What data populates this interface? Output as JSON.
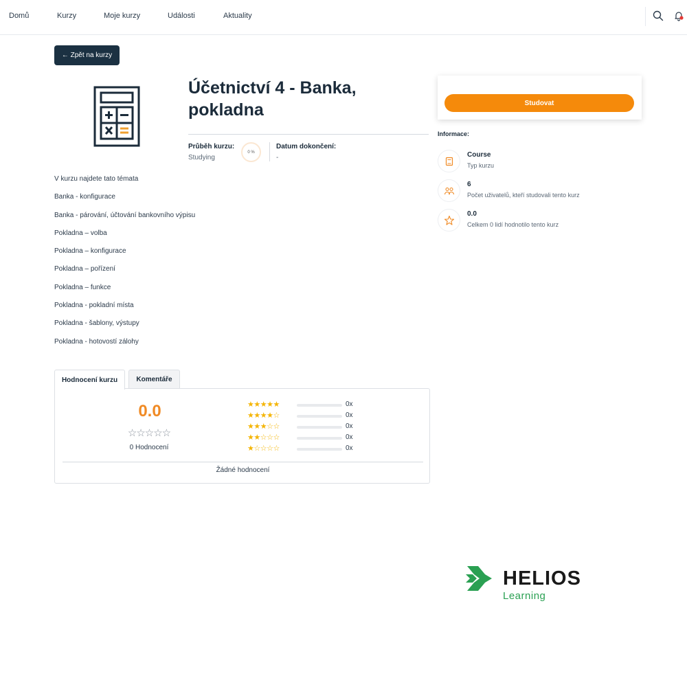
{
  "nav": {
    "items": [
      "Domů",
      "Kurzy",
      "Moje kurzy",
      "Události",
      "Aktuality"
    ],
    "icons": [
      "search-icon",
      "bell-icon"
    ]
  },
  "back_button": "← Zpět na kurzy",
  "course": {
    "title_line1": "Účetnictví 4 - Banka,",
    "title_line2": "pokladna",
    "progress_label": "Průběh kurzu:",
    "progress_status": "Studying",
    "progress_percent": "0 %",
    "completion_label": "Datum dokončení:",
    "completion_value": "-",
    "icon": "calculator-icon"
  },
  "topics": [
    "V kurzu najdete tato témata",
    "Banka  - konfigurace",
    "Banka - párování, účtování bankovního výpisu",
    "Pokladna – volba",
    "Pokladna – konfigurace",
    "Pokladna – pořízení",
    "Pokladna – funkce",
    "Pokladna - pokladní místa",
    "Pokladna - šablony, výstupy",
    "Pokladna - hotovostí zálohy"
  ],
  "study_button": "Studovat",
  "info": {
    "heading": "Informace:",
    "rows": [
      {
        "value": "Course",
        "label": "Typ kurzu",
        "icon": "book-icon"
      },
      {
        "value": "6",
        "label": "Počet uživatelů, kteří studovali tento kurz",
        "icon": "users-icon"
      },
      {
        "value": "0.0",
        "label": "Celkem 0 lidí hodnotilo tento kurz",
        "icon": "star-badge-icon"
      }
    ]
  },
  "tabs": [
    "Hodnocení kurzu",
    "Komentáře"
  ],
  "rating": {
    "average": "0.0",
    "average_stars": "☆☆☆☆☆",
    "count_label": "0 Hodnocení",
    "distribution": [
      {
        "stars": 5,
        "filled": "★★★★★",
        "empty": "",
        "count": "0x"
      },
      {
        "stars": 4,
        "filled": "★★★★",
        "empty": "☆",
        "count": "0x"
      },
      {
        "stars": 3,
        "filled": "★★★",
        "empty": "☆☆",
        "count": "0x"
      },
      {
        "stars": 2,
        "filled": "★★",
        "empty": "☆☆☆",
        "count": "0x"
      },
      {
        "stars": 1,
        "filled": "★",
        "empty": "☆☆☆☆",
        "count": "0x"
      }
    ],
    "no_ratings": "Žádné hodnocení"
  },
  "logo": {
    "word": "HELIOS",
    "sub": "Learning"
  },
  "colors": {
    "accent": "#f58a0b",
    "dark": "#1b3142",
    "star": "#f4b400",
    "logo_green": "#2aa052"
  }
}
